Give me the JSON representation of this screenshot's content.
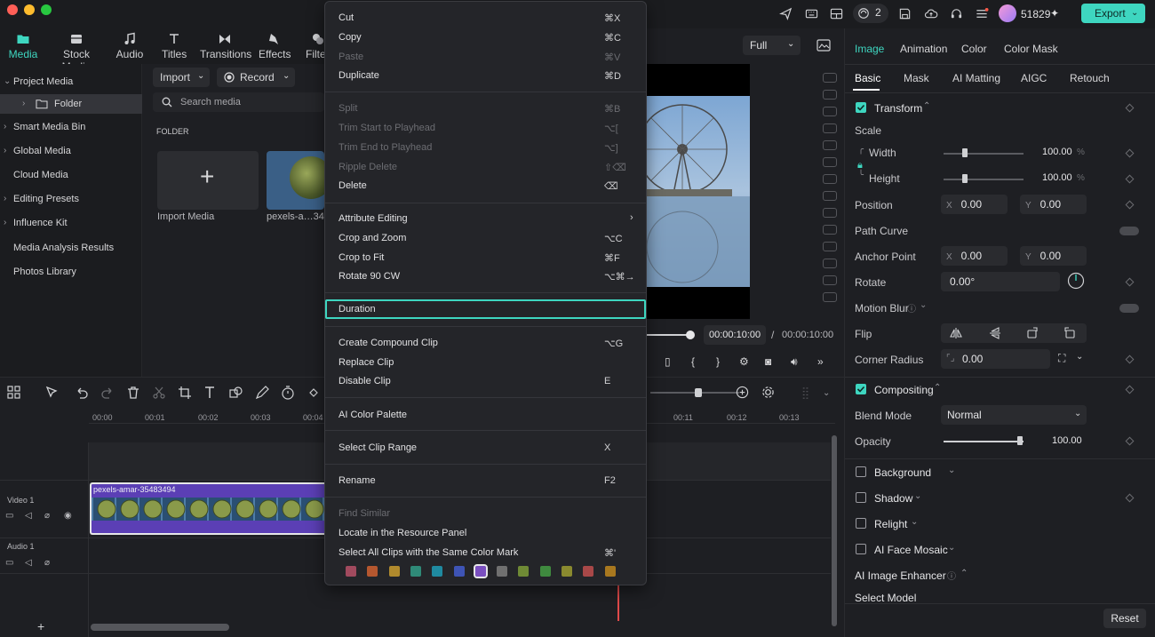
{
  "titlebar": {
    "credits": "51829",
    "notif_count": "2",
    "export_label": "Export"
  },
  "media_nav": {
    "tabs": [
      {
        "label": "Media",
        "icon": "folder-icon"
      },
      {
        "label": "Stock Media",
        "icon": "stock-media-icon"
      },
      {
        "label": "Audio",
        "icon": "music-note-icon"
      },
      {
        "label": "Titles",
        "icon": "text-t-icon"
      },
      {
        "label": "Transitions",
        "icon": "bowtie-icon"
      },
      {
        "label": "Effects",
        "icon": "effects-icon"
      },
      {
        "label": "Filte",
        "icon": "filter-icon"
      }
    ]
  },
  "library": {
    "items": [
      {
        "label": "Project Media",
        "expanded": true
      },
      {
        "label": "Folder",
        "selected": true
      },
      {
        "label": "Smart Media Bin"
      },
      {
        "label": "Global Media"
      },
      {
        "label": "Cloud Media"
      },
      {
        "label": "Editing Presets"
      },
      {
        "label": "Influence Kit"
      },
      {
        "label": "Media Analysis Results"
      },
      {
        "label": "Photos Library"
      }
    ]
  },
  "media": {
    "import_label": "Import",
    "record_label": "Record",
    "search_placeholder": "Search media",
    "folder_heading": "FOLDER",
    "import_media_label": "Import Media",
    "clip_label": "pexels-a…34!"
  },
  "preview": {
    "quality": "Full",
    "current_time": "00:00:10:00",
    "separator": "/",
    "total_time": "00:00:10:00"
  },
  "timeline": {
    "ruler": [
      "00:00",
      "00:01",
      "00:02",
      "00:03",
      "00:04",
      "00:11",
      "00:12",
      "00:13"
    ],
    "video_track": "Video 1",
    "audio_track": "Audio 1",
    "clip_name": "pexels-amar-35483494"
  },
  "context_menu": {
    "items": [
      {
        "label": "Cut",
        "shortcut": "⌘X",
        "disabled": false
      },
      {
        "label": "Copy",
        "shortcut": "⌘C",
        "disabled": false
      },
      {
        "label": "Paste",
        "shortcut": "⌘V",
        "disabled": true
      },
      {
        "label": "Duplicate",
        "shortcut": "⌘D",
        "disabled": false
      },
      {
        "label": "Split",
        "shortcut": "⌘B",
        "disabled": true
      },
      {
        "label": "Trim Start to Playhead",
        "shortcut": "⌥[",
        "disabled": true
      },
      {
        "label": "Trim End to Playhead",
        "shortcut": "⌥]",
        "disabled": true
      },
      {
        "label": "Ripple Delete",
        "shortcut": "⇧⌫",
        "disabled": true
      },
      {
        "label": "Delete",
        "shortcut": "⌫",
        "disabled": false
      },
      {
        "label": "Attribute Editing",
        "shortcut": "›",
        "disabled": false
      },
      {
        "label": "Crop and Zoom",
        "shortcut": "⌥C",
        "disabled": false
      },
      {
        "label": "Crop to Fit",
        "shortcut": "⌘F",
        "disabled": false
      },
      {
        "label": "Rotate 90 CW",
        "shortcut": "⌥⌘→",
        "disabled": false
      },
      {
        "label": "Duration",
        "shortcut": "",
        "disabled": false,
        "highlighted": true
      },
      {
        "label": "Create Compound Clip",
        "shortcut": "⌥G",
        "disabled": false
      },
      {
        "label": "Replace Clip",
        "shortcut": "",
        "disabled": false
      },
      {
        "label": "Disable Clip",
        "shortcut": "E",
        "disabled": false
      },
      {
        "label": "AI Color Palette",
        "shortcut": "",
        "disabled": false
      },
      {
        "label": "Select Clip Range",
        "shortcut": "X",
        "disabled": false
      },
      {
        "label": "Rename",
        "shortcut": "F2",
        "disabled": false
      },
      {
        "label": "Find Similar",
        "shortcut": "",
        "disabled": true
      },
      {
        "label": "Locate in the Resource Panel",
        "shortcut": "",
        "disabled": false
      },
      {
        "label": "Select All Clips with the Same Color Mark",
        "shortcut": "⌘'",
        "disabled": false
      }
    ],
    "color_marks": [
      "#a14a5e",
      "#b5572f",
      "#b08a2d",
      "#2f8a78",
      "#1f8aa0",
      "#3e54b5",
      "#7a4fc0",
      "#707070",
      "#6f8a35",
      "#3f8a3f",
      "#8a8a2f",
      "#a84848",
      "#a8781f"
    ]
  },
  "right_panel": {
    "top_tabs": [
      "Image",
      "Animation",
      "Color",
      "Color Mask"
    ],
    "sub_tabs": [
      "Basic",
      "Mask",
      "AI Matting",
      "AIGC",
      "Retouch"
    ],
    "transform": "Transform",
    "scale": "Scale",
    "width_label": "Width",
    "width_value": "100.00",
    "height_label": "Height",
    "height_value": "100.00",
    "percent": "%",
    "position": "Position",
    "pos_x": "0.00",
    "pos_y": "0.00",
    "x_key": "X",
    "y_key": "Y",
    "path_curve": "Path Curve",
    "anchor_point": "Anchor Point",
    "anchor_x": "0.00",
    "anchor_y": "0.00",
    "rotate": "Rotate",
    "rotate_value": "0.00°",
    "motion_blur": "Motion Blur",
    "flip": "Flip",
    "corner_radius": "Corner Radius",
    "corner_value": "0.00",
    "compositing": "Compositing",
    "blend_mode": "Blend Mode",
    "blend_value": "Normal",
    "opacity": "Opacity",
    "opacity_value": "100.00",
    "background": "Background",
    "shadow": "Shadow",
    "relight": "Relight",
    "ai_face_mosaic": "AI Face Mosaic",
    "ai_image_enhancer": "AI Image Enhancer",
    "select_model": "Select Model",
    "reset": "Reset"
  },
  "colors": {
    "accent": "#3ed6c0",
    "clip": "#5b3fb5"
  }
}
